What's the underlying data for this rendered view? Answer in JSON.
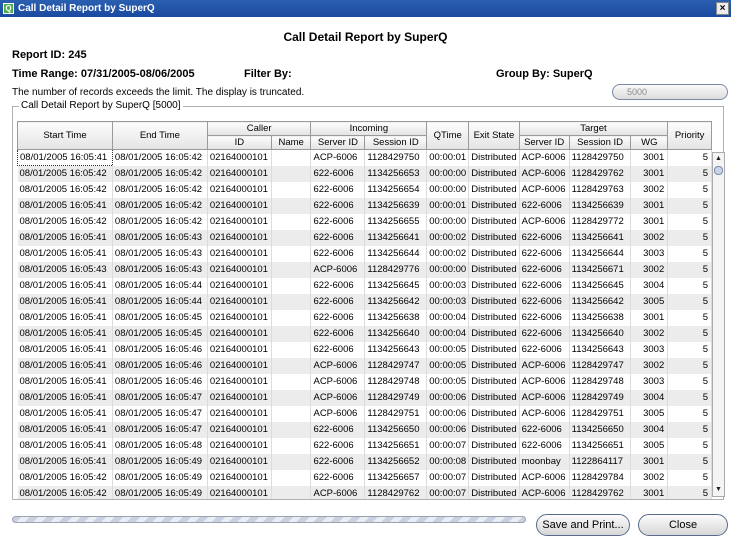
{
  "window": {
    "title": "Call Detail Report by SuperQ",
    "close_glyph": "×"
  },
  "report": {
    "title": "Call Detail Report by SuperQ",
    "id_label": "Report ID: 245",
    "time_range": "Time Range: 07/31/2005-08/06/2005",
    "filter_by": "Filter By:",
    "group_by": "Group By: SuperQ",
    "truncated_msg": "The number of records exceeds the limit. The display is truncated.",
    "group_label": "Call Detail Report by SuperQ [5000]",
    "limit_value": "5000"
  },
  "table": {
    "group_headers": {
      "caller": "Caller",
      "incoming": "Incoming",
      "target": "Target"
    },
    "columns": {
      "start_time": "Start Time",
      "end_time": "End Time",
      "caller_id": "ID",
      "caller_name": "Name",
      "in_server_id": "Server ID",
      "in_session_id": "Session ID",
      "qtime": "QTime",
      "exit_state": "Exit State",
      "t_server_id": "Server ID",
      "t_session_id": "Session ID",
      "t_wg": "WG",
      "priority": "Priority"
    },
    "rows": [
      [
        "08/01/2005 16:05:41",
        "08/01/2005 16:05:42",
        "02164000101",
        "",
        "ACP-6006",
        "1128429750",
        "00:00:01",
        "Distributed",
        "ACP-6006",
        "1128429750",
        "3001",
        "5"
      ],
      [
        "08/01/2005 16:05:42",
        "08/01/2005 16:05:42",
        "02164000101",
        "",
        "622-6006",
        "1134256653",
        "00:00:00",
        "Distributed",
        "ACP-6006",
        "1128429762",
        "3001",
        "5"
      ],
      [
        "08/01/2005 16:05:42",
        "08/01/2005 16:05:42",
        "02164000101",
        "",
        "622-6006",
        "1134256654",
        "00:00:00",
        "Distributed",
        "ACP-6006",
        "1128429763",
        "3002",
        "5"
      ],
      [
        "08/01/2005 16:05:41",
        "08/01/2005 16:05:42",
        "02164000101",
        "",
        "622-6006",
        "1134256639",
        "00:00:01",
        "Distributed",
        "622-6006",
        "1134256639",
        "3001",
        "5"
      ],
      [
        "08/01/2005 16:05:42",
        "08/01/2005 16:05:42",
        "02164000101",
        "",
        "622-6006",
        "1134256655",
        "00:00:00",
        "Distributed",
        "ACP-6006",
        "1128429772",
        "3001",
        "5"
      ],
      [
        "08/01/2005 16:05:41",
        "08/01/2005 16:05:43",
        "02164000101",
        "",
        "622-6006",
        "1134256641",
        "00:00:02",
        "Distributed",
        "622-6006",
        "1134256641",
        "3002",
        "5"
      ],
      [
        "08/01/2005 16:05:41",
        "08/01/2005 16:05:43",
        "02164000101",
        "",
        "622-6006",
        "1134256644",
        "00:00:02",
        "Distributed",
        "622-6006",
        "1134256644",
        "3003",
        "5"
      ],
      [
        "08/01/2005 16:05:43",
        "08/01/2005 16:05:43",
        "02164000101",
        "",
        "ACP-6006",
        "1128429776",
        "00:00:00",
        "Distributed",
        "622-6006",
        "1134256671",
        "3002",
        "5"
      ],
      [
        "08/01/2005 16:05:41",
        "08/01/2005 16:05:44",
        "02164000101",
        "",
        "622-6006",
        "1134256645",
        "00:00:03",
        "Distributed",
        "622-6006",
        "1134256645",
        "3004",
        "5"
      ],
      [
        "08/01/2005 16:05:41",
        "08/01/2005 16:05:44",
        "02164000101",
        "",
        "622-6006",
        "1134256642",
        "00:00:03",
        "Distributed",
        "622-6006",
        "1134256642",
        "3005",
        "5"
      ],
      [
        "08/01/2005 16:05:41",
        "08/01/2005 16:05:45",
        "02164000101",
        "",
        "622-6006",
        "1134256638",
        "00:00:04",
        "Distributed",
        "622-6006",
        "1134256638",
        "3001",
        "5"
      ],
      [
        "08/01/2005 16:05:41",
        "08/01/2005 16:05:45",
        "02164000101",
        "",
        "622-6006",
        "1134256640",
        "00:00:04",
        "Distributed",
        "622-6006",
        "1134256640",
        "3002",
        "5"
      ],
      [
        "08/01/2005 16:05:41",
        "08/01/2005 16:05:46",
        "02164000101",
        "",
        "622-6006",
        "1134256643",
        "00:00:05",
        "Distributed",
        "622-6006",
        "1134256643",
        "3003",
        "5"
      ],
      [
        "08/01/2005 16:05:41",
        "08/01/2005 16:05:46",
        "02164000101",
        "",
        "ACP-6006",
        "1128429747",
        "00:00:05",
        "Distributed",
        "ACP-6006",
        "1128429747",
        "3002",
        "5"
      ],
      [
        "08/01/2005 16:05:41",
        "08/01/2005 16:05:46",
        "02164000101",
        "",
        "ACP-6006",
        "1128429748",
        "00:00:05",
        "Distributed",
        "ACP-6006",
        "1128429748",
        "3003",
        "5"
      ],
      [
        "08/01/2005 16:05:41",
        "08/01/2005 16:05:47",
        "02164000101",
        "",
        "ACP-6006",
        "1128429749",
        "00:00:06",
        "Distributed",
        "ACP-6006",
        "1128429749",
        "3004",
        "5"
      ],
      [
        "08/01/2005 16:05:41",
        "08/01/2005 16:05:47",
        "02164000101",
        "",
        "ACP-6006",
        "1128429751",
        "00:00:06",
        "Distributed",
        "ACP-6006",
        "1128429751",
        "3005",
        "5"
      ],
      [
        "08/01/2005 16:05:41",
        "08/01/2005 16:05:47",
        "02164000101",
        "",
        "622-6006",
        "1134256650",
        "00:00:06",
        "Distributed",
        "622-6006",
        "1134256650",
        "3004",
        "5"
      ],
      [
        "08/01/2005 16:05:41",
        "08/01/2005 16:05:48",
        "02164000101",
        "",
        "622-6006",
        "1134256651",
        "00:00:07",
        "Distributed",
        "622-6006",
        "1134256651",
        "3005",
        "5"
      ],
      [
        "08/01/2005 16:05:41",
        "08/01/2005 16:05:49",
        "02164000101",
        "",
        "622-6006",
        "1134256652",
        "00:00:08",
        "Distributed",
        "moonbay",
        "1122864117",
        "3001",
        "5"
      ],
      [
        "08/01/2005 16:05:42",
        "08/01/2005 16:05:49",
        "02164000101",
        "",
        "622-6006",
        "1134256657",
        "00:00:07",
        "Distributed",
        "ACP-6006",
        "1128429784",
        "3002",
        "5"
      ],
      [
        "08/01/2005 16:05:42",
        "08/01/2005 16:05:49",
        "02164000101",
        "",
        "ACP-6006",
        "1128429762",
        "00:00:07",
        "Distributed",
        "ACP-6006",
        "1128429762",
        "3001",
        "5"
      ]
    ]
  },
  "buttons": {
    "save_print": "Save and Print...",
    "close": "Close"
  },
  "icons": {
    "app": "superq-app-icon",
    "scroll_up": "scroll-up-arrow-icon",
    "scroll_down": "scroll-down-arrow-icon"
  }
}
